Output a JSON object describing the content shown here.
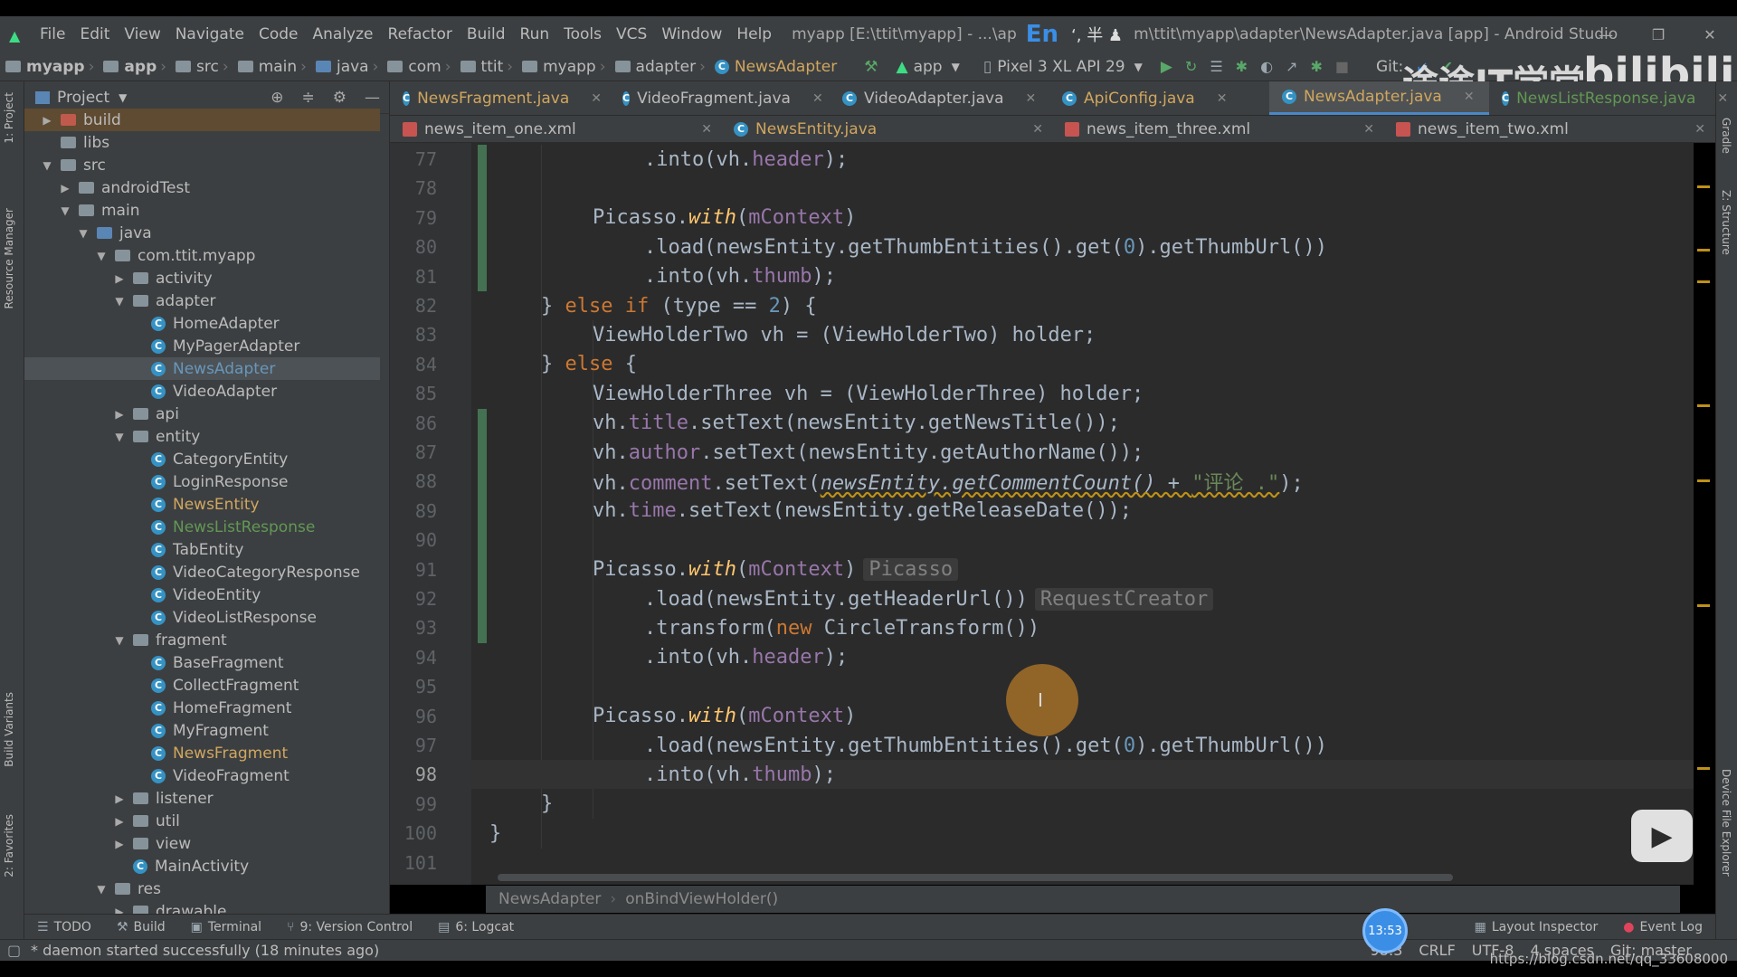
{
  "window": {
    "menu": [
      "File",
      "Edit",
      "View",
      "Navigate",
      "Code",
      "Analyze",
      "Refactor",
      "Build",
      "Run",
      "Tools",
      "VCS",
      "Window",
      "Help"
    ],
    "title": "myapp [E:\\ttit\\myapp] - ...\\ap",
    "title_suffix": "m\\ttit\\myapp\\adapter\\NewsAdapter.java [app] - Android Studio",
    "ime": "En"
  },
  "navbar": {
    "crumbs": [
      "myapp",
      "app",
      "src",
      "main",
      "java",
      "com",
      "ttit",
      "myapp",
      "adapter",
      "NewsAdapter"
    ],
    "run_config": "app",
    "device": "Pixel 3 XL API 29",
    "git_label": "Git:"
  },
  "watermark": {
    "text": "途途IT学堂",
    "logo": "bilibili"
  },
  "project_panel": {
    "title": "Project",
    "rows": [
      {
        "label": "build",
        "arrow": "▶",
        "indent": 1,
        "type": "folder-orange",
        "style": "excluded"
      },
      {
        "label": "libs",
        "arrow": "",
        "indent": 1,
        "type": "folder"
      },
      {
        "label": "src",
        "arrow": "▼",
        "indent": 1,
        "type": "folder"
      },
      {
        "label": "androidTest",
        "arrow": "▶",
        "indent": 2,
        "type": "folder"
      },
      {
        "label": "main",
        "arrow": "▼",
        "indent": 2,
        "type": "folder"
      },
      {
        "label": "java",
        "arrow": "▼",
        "indent": 3,
        "type": "folder-blue"
      },
      {
        "label": "com.ttit.myapp",
        "arrow": "▼",
        "indent": 4,
        "type": "folder"
      },
      {
        "label": "activity",
        "arrow": "▶",
        "indent": 5,
        "type": "folder"
      },
      {
        "label": "adapter",
        "arrow": "▼",
        "indent": 5,
        "type": "folder"
      },
      {
        "label": "HomeAdapter",
        "arrow": "",
        "indent": 6,
        "type": "class"
      },
      {
        "label": "MyPagerAdapter",
        "arrow": "",
        "indent": 6,
        "type": "class"
      },
      {
        "label": "NewsAdapter",
        "arrow": "",
        "indent": 6,
        "type": "class",
        "style": "selected",
        "color": "mod"
      },
      {
        "label": "VideoAdapter",
        "arrow": "",
        "indent": 6,
        "type": "class"
      },
      {
        "label": "api",
        "arrow": "▶",
        "indent": 5,
        "type": "folder"
      },
      {
        "label": "entity",
        "arrow": "▼",
        "indent": 5,
        "type": "folder"
      },
      {
        "label": "CategoryEntity",
        "arrow": "",
        "indent": 6,
        "type": "class"
      },
      {
        "label": "LoginResponse",
        "arrow": "",
        "indent": 6,
        "type": "class"
      },
      {
        "label": "NewsEntity",
        "arrow": "",
        "indent": 6,
        "type": "class",
        "color": "chg"
      },
      {
        "label": "NewsListResponse",
        "arrow": "",
        "indent": 6,
        "type": "class",
        "color": "add"
      },
      {
        "label": "TabEntity",
        "arrow": "",
        "indent": 6,
        "type": "class"
      },
      {
        "label": "VideoCategoryResponse",
        "arrow": "",
        "indent": 6,
        "type": "class"
      },
      {
        "label": "VideoEntity",
        "arrow": "",
        "indent": 6,
        "type": "class"
      },
      {
        "label": "VideoListResponse",
        "arrow": "",
        "indent": 6,
        "type": "class"
      },
      {
        "label": "fragment",
        "arrow": "▼",
        "indent": 5,
        "type": "folder"
      },
      {
        "label": "BaseFragment",
        "arrow": "",
        "indent": 6,
        "type": "class"
      },
      {
        "label": "CollectFragment",
        "arrow": "",
        "indent": 6,
        "type": "class"
      },
      {
        "label": "HomeFragment",
        "arrow": "",
        "indent": 6,
        "type": "class"
      },
      {
        "label": "MyFragment",
        "arrow": "",
        "indent": 6,
        "type": "class"
      },
      {
        "label": "NewsFragment",
        "arrow": "",
        "indent": 6,
        "type": "class",
        "color": "chg"
      },
      {
        "label": "VideoFragment",
        "arrow": "",
        "indent": 6,
        "type": "class"
      },
      {
        "label": "listener",
        "arrow": "▶",
        "indent": 5,
        "type": "folder"
      },
      {
        "label": "util",
        "arrow": "▶",
        "indent": 5,
        "type": "folder"
      },
      {
        "label": "view",
        "arrow": "▶",
        "indent": 5,
        "type": "folder"
      },
      {
        "label": "MainActivity",
        "arrow": "",
        "indent": 5,
        "type": "class"
      },
      {
        "label": "res",
        "arrow": "▼",
        "indent": 4,
        "type": "folder"
      },
      {
        "label": "drawable",
        "arrow": "▶",
        "indent": 5,
        "type": "folder"
      }
    ]
  },
  "left_tabs": [
    "1: Project",
    "Resource Manager",
    "Build Variants",
    "2: Favorites"
  ],
  "right_tabs": [
    "Gradle",
    "Z: Structure",
    "Device File Explorer"
  ],
  "editor_tabs_row1": [
    {
      "label": "NewsFragment.java",
      "color": "chg"
    },
    {
      "label": "VideoFragment.java",
      "color": "normal"
    },
    {
      "label": "VideoAdapter.java",
      "color": "normal"
    },
    {
      "label": "ApiConfig.java",
      "color": "chg"
    },
    {
      "label": "NewsAdapter.java",
      "color": "chg",
      "active": true
    },
    {
      "label": "NewsListResponse.java",
      "color": "add"
    }
  ],
  "editor_tabs_row2": [
    {
      "label": "news_item_one.xml"
    },
    {
      "label": "NewsEntity.java"
    },
    {
      "label": "news_item_three.xml"
    },
    {
      "label": "news_item_two.xml"
    }
  ],
  "code_lines": [
    {
      "n": "77",
      "html": "<span class='call'>.into(vh.</span><span class='fld'>header</span><span class='call'>);</span>",
      "indent": 3
    },
    {
      "n": "78",
      "html": "",
      "indent": 0
    },
    {
      "n": "79",
      "html": "<span class='cls'>Picasso.</span><span class='mtd-i'>with</span><span class='call'>(</span><span class='fld'>mContext</span><span class='call'>)</span>",
      "indent": 2
    },
    {
      "n": "80",
      "html": "<span class='call'>.load(newsEntity.getThumbEntities().get(</span><span class='num'>0</span><span class='call'>).getThumbUrl())</span>",
      "indent": 3
    },
    {
      "n": "81",
      "html": "<span class='call'>.into(vh.</span><span class='fld'>thumb</span><span class='call'>);</span>",
      "indent": 3
    },
    {
      "n": "82",
      "html": "<span class='call'>} </span><span class='kw'>else if</span><span class='call'> (type == </span><span class='num'>2</span><span class='call'>) {</span>",
      "indent": 1
    },
    {
      "n": "83",
      "html": "<span class='cls'>ViewHolderTwo </span><span class='call'>vh = (ViewHolderTwo) holder;</span>",
      "indent": 2
    },
    {
      "n": "84",
      "html": "<span class='call'>} </span><span class='kw'>else</span><span class='call'> {</span>",
      "indent": 1
    },
    {
      "n": "85",
      "html": "<span class='cls'>ViewHolderThree vh = (ViewHolderThree) holder;</span>",
      "indent": 2
    },
    {
      "n": "86",
      "html": "<span class='call'>vh.</span><span class='fld'>title</span><span class='call'>.setText(newsEntity.getNewsTitle());</span>",
      "indent": 2
    },
    {
      "n": "87",
      "html": "<span class='call'>vh.</span><span class='fld'>author</span><span class='call'>.setText(newsEntity.getAuthorName());</span>",
      "indent": 2
    },
    {
      "n": "88",
      "html": "<span class='call'>vh.</span><span class='fld'>comment</span><span class='call'>.setText(</span><span class='call' style='font-style:italic;text-decoration:underline wavy #be9117'>newsEntity.getCommentCount() + </span><span class='str' style='text-decoration:underline wavy #be9117'>\"评论 .\"</span><span class='call'>);</span>",
      "indent": 2
    },
    {
      "n": "89",
      "html": "<span class='call'>vh.</span><span class='fld'>time</span><span class='call'>.setText(newsEntity.getReleaseDate());</span>",
      "indent": 2
    },
    {
      "n": "90",
      "html": "",
      "indent": 0
    },
    {
      "n": "91",
      "html": "<span class='cls'>Picasso.</span><span class='mtd-i'>with</span><span class='call'>(</span><span class='fld'>mContext</span><span class='call'>)</span><span class='hint'>Picasso</span>",
      "indent": 2
    },
    {
      "n": "92",
      "html": "<span class='call'>.load(newsEntity.getHeaderUrl())</span><span class='hint'>RequestCreator</span>",
      "indent": 3
    },
    {
      "n": "93",
      "html": "<span class='call'>.transform(</span><span class='kw'>new </span><span class='call'>CircleTransform())</span>",
      "indent": 3
    },
    {
      "n": "94",
      "html": "<span class='call'>.into(vh.</span><span class='fld'>header</span><span class='call'>);</span>",
      "indent": 3
    },
    {
      "n": "95",
      "html": "",
      "indent": 0
    },
    {
      "n": "96",
      "html": "<span class='cls'>Picasso.</span><span class='mtd-i'>with</span><span class='call'>(</span><span class='fld'>mContext</span><span class='call'>)</span>",
      "indent": 2
    },
    {
      "n": "97",
      "html": "<span class='call'>.load(newsEntity.getThumbEntities().get(</span><span class='num'>0</span><span class='call'>).getThumbUrl())</span>",
      "indent": 3
    },
    {
      "n": "98",
      "html": "<span class='call'>.into(vh.</span><span class='fld'>thumb</span><span class='call'>);</span>",
      "indent": 3,
      "current": true
    },
    {
      "n": "99",
      "html": "<span class='call'>}</span>",
      "indent": 1
    },
    {
      "n": "100",
      "html": "<span class='call'>}</span>",
      "indent": 0
    },
    {
      "n": "101",
      "html": "",
      "indent": 0
    }
  ],
  "breadcrumb": {
    "cls": "NewsAdapter",
    "method": "onBindViewHolder()"
  },
  "bottom_tabs": [
    "TODO",
    "Build",
    "Terminal",
    "9: Version Control",
    "6: Logcat"
  ],
  "bottom_right_tabs": [
    "Layout Inspector",
    "Event Log"
  ],
  "status": {
    "message": "* daemon started successfully (18 minutes ago)",
    "position": "98:3",
    "line_sep": "CRLF",
    "encoding": "UTF-8",
    "indent": "4 spaces",
    "git": "Git: master",
    "timer": "13:53",
    "url": "https://blog.csdn.net/qq_33608000"
  }
}
